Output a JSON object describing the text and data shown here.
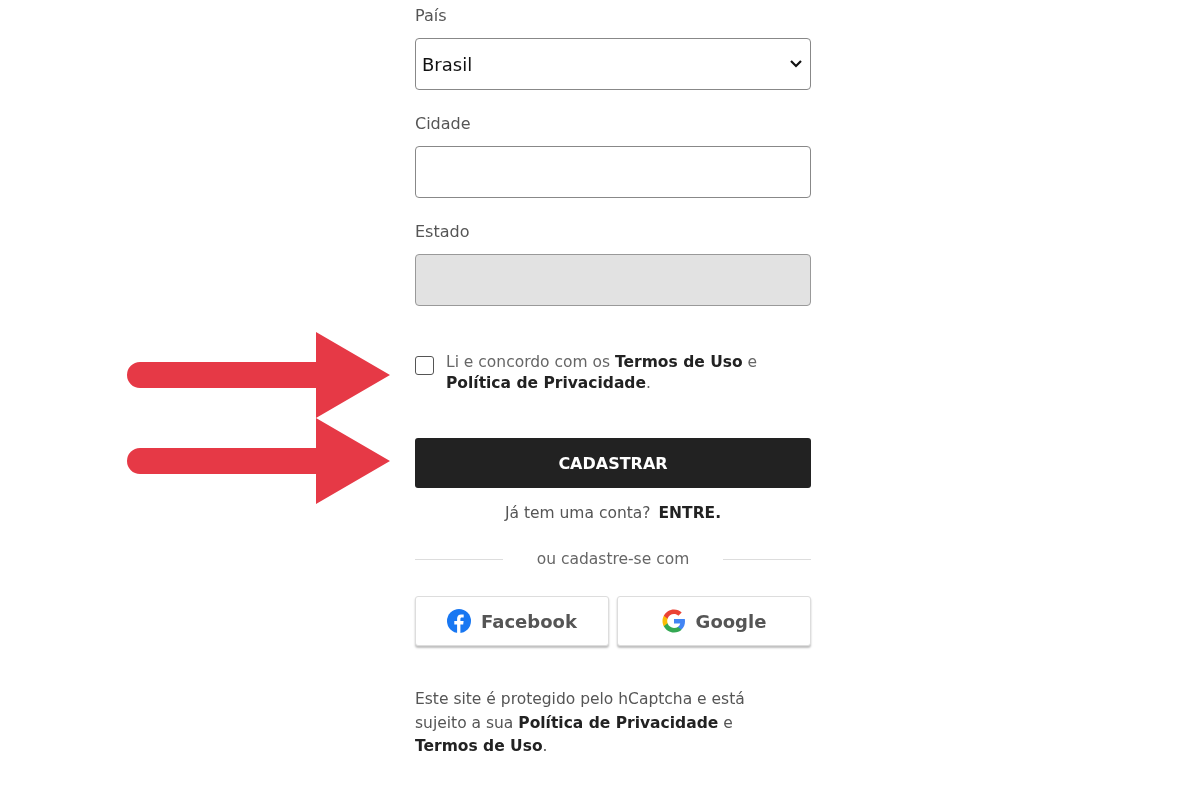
{
  "fields": [
    {
      "label": "País",
      "kind": "select",
      "value": "Brasil",
      "disabled": false
    },
    {
      "label": "Cidade",
      "kind": "text",
      "disabled": false
    },
    {
      "label": "Estado",
      "kind": "text",
      "disabled": true
    }
  ],
  "consent": {
    "checked": false,
    "text": "Li e concordo com os **Termos de Uso** e **Política de Privacidade**."
  },
  "submit_button": "CADASTRAR",
  "login": {
    "prompt": "Já tem uma conta?",
    "link": "ENTRE."
  },
  "divider_text": "ou cadastre-se com",
  "social_buttons": [
    {
      "kind": "facebook",
      "label": "Facebook"
    },
    {
      "kind": "google",
      "label": "Google"
    }
  ],
  "footer": "Este site é protegido pelo hCaptcha e está sujeito a sua **Política de Privacidade** e **Termos de Uso**.",
  "annotations": [
    {
      "kind": "arrow"
    },
    {
      "kind": "arrow"
    }
  ]
}
